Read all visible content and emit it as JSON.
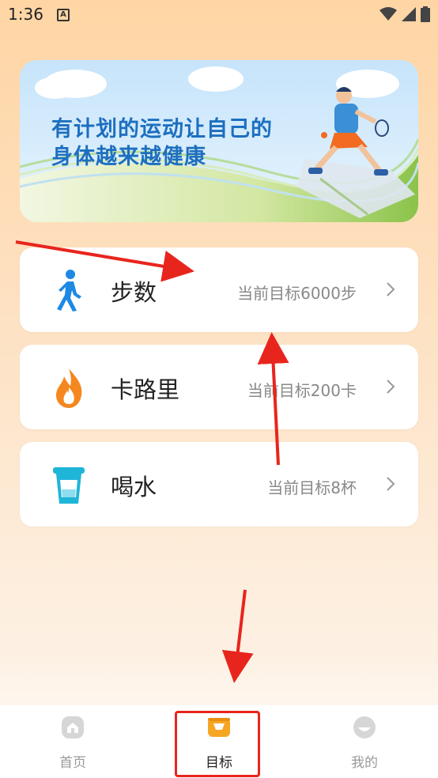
{
  "status": {
    "time": "1:36"
  },
  "banner": {
    "line1": "有计划的运动让自己的",
    "line2": "身体越来越健康"
  },
  "cards": [
    {
      "title": "步数",
      "goal": "当前目标6000步",
      "icon": "walking-person-icon"
    },
    {
      "title": "卡路里",
      "goal": "当前目标200卡",
      "icon": "flame-icon"
    },
    {
      "title": "喝水",
      "goal": "当前目标8杯",
      "icon": "cup-icon"
    }
  ],
  "tabs": [
    {
      "label": "首页",
      "icon": "home-icon"
    },
    {
      "label": "目标",
      "icon": "target-icon",
      "active": true
    },
    {
      "label": "我的",
      "icon": "profile-icon"
    }
  ],
  "colors": {
    "accent": "#1d6fbf",
    "annotation": "#e8251d",
    "active_tab": "#f5a623"
  }
}
